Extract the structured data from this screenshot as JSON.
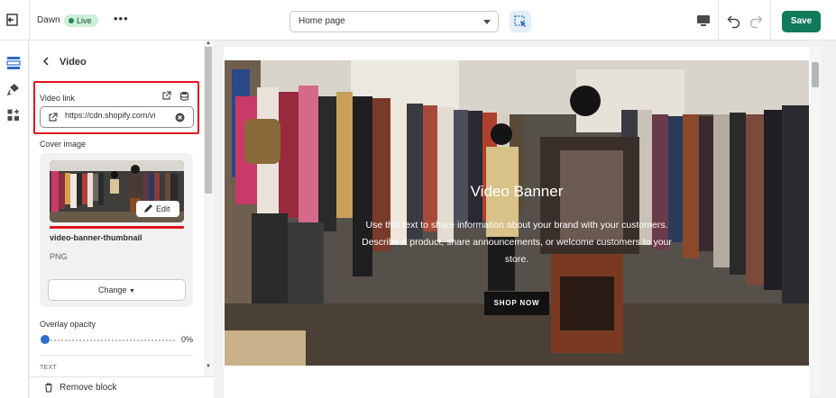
{
  "topbar": {
    "theme_name": "Dawn",
    "live_label": "Live",
    "more_label": "•••",
    "page_selector_value": "Home page",
    "save_label": "Save"
  },
  "panel": {
    "title": "Video",
    "video_link_label": "Video link",
    "video_link_value": "https://cdn.shopify.com/vi",
    "cover_image_label": "Cover image",
    "edit_label": "Edit",
    "file_name": "video-banner-thumbnail",
    "file_type": "PNG",
    "change_label": "Change",
    "overlay_label": "Overlay opacity",
    "overlay_value_text": "0%",
    "overlay_value": 0,
    "text_section_label": "TEXT",
    "remove_label": "Remove block"
  },
  "banner": {
    "heading": "Video Banner",
    "body": "Use this text to share information about your brand with your customers. Describe a product, share announcements, or welcome customers to your store.",
    "button_label": "SHOP NOW"
  },
  "colors": {
    "accent": "#107a5b",
    "highlight": "#e0141e",
    "live_badge": "#cdefd9",
    "slider": "#2c6ecb"
  },
  "icons": [
    "exit-icon",
    "inspect-icon",
    "desktop-icon",
    "undo-icon",
    "redo-icon",
    "sections-icon",
    "theme-settings-icon",
    "app-blocks-icon",
    "back-icon",
    "external-link-icon",
    "database-icon",
    "link-icon",
    "clear-icon",
    "pencil-icon",
    "trash-icon"
  ]
}
